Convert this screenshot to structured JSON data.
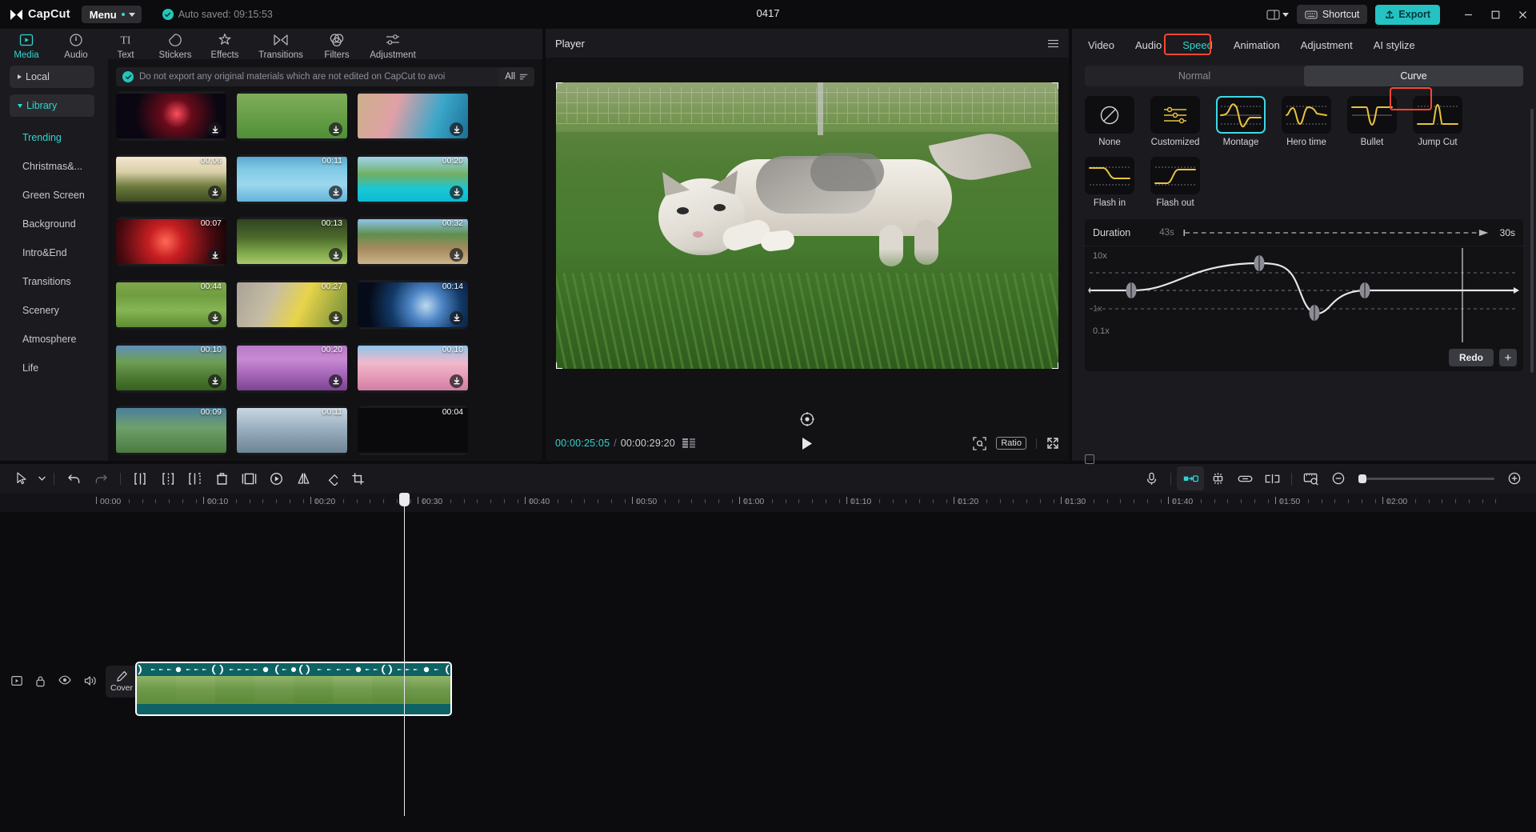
{
  "titlebar": {
    "app_name": "CapCut",
    "menu_label": "Menu",
    "autosave_text": "Auto saved: 09:15:53",
    "project_title": "0417",
    "shortcut_label": "Shortcut",
    "export_label": "Export",
    "minimize_icon": "minimize-icon",
    "maximize_icon": "maximize-icon",
    "close_icon": "close-icon",
    "layout_icon": "layout-icon"
  },
  "nav_tabs": [
    {
      "label": "Media",
      "icon": "media-icon",
      "active": true
    },
    {
      "label": "Audio",
      "icon": "audio-icon",
      "active": false
    },
    {
      "label": "Text",
      "icon": "text-icon",
      "active": false
    },
    {
      "label": "Stickers",
      "icon": "stickers-icon",
      "active": false
    },
    {
      "label": "Effects",
      "icon": "effects-icon",
      "active": false
    },
    {
      "label": "Transitions",
      "icon": "transitions-icon",
      "active": false
    },
    {
      "label": "Filters",
      "icon": "filters-icon",
      "active": false
    },
    {
      "label": "Adjustment",
      "icon": "adjustment-icon",
      "active": false
    }
  ],
  "library": {
    "local_label": "Local",
    "library_label": "Library",
    "categories": [
      {
        "label": "Trending",
        "active": true
      },
      {
        "label": "Christmas&...",
        "active": false
      },
      {
        "label": "Green Screen",
        "active": false
      },
      {
        "label": "Background",
        "active": false
      },
      {
        "label": "Intro&End",
        "active": false
      },
      {
        "label": "Transitions",
        "active": false
      },
      {
        "label": "Scenery",
        "active": false
      },
      {
        "label": "Atmosphere",
        "active": false
      },
      {
        "label": "Life",
        "active": false
      }
    ]
  },
  "notice": {
    "text": "Do not export any original materials which are not edited on CapCut to avoi",
    "close_icon": "close-icon",
    "shield_icon": "shield-check-icon"
  },
  "filter": {
    "label": "All",
    "icon": "filter-icon"
  },
  "media_grid": [
    {
      "duration": "",
      "thumb": "fireworks-dark",
      "downloadable": true
    },
    {
      "duration": "",
      "thumb": "cheer-team-grass",
      "downloadable": true
    },
    {
      "duration": "",
      "thumb": "beach-cliff-people",
      "downloadable": true
    },
    {
      "duration": "00:06",
      "thumb": "forest-sunrise",
      "downloadable": true
    },
    {
      "duration": "00:11",
      "thumb": "ocean-blue",
      "downloadable": true
    },
    {
      "duration": "00:20",
      "thumb": "pool-summer",
      "downloadable": true
    },
    {
      "duration": "00:07",
      "thumb": "fireworks-red",
      "downloadable": true
    },
    {
      "duration": "00:13",
      "thumb": "family-park",
      "downloadable": true
    },
    {
      "duration": "00:32",
      "thumb": "hiker-trail",
      "downloadable": true
    },
    {
      "duration": "00:44",
      "thumb": "kitten-grass",
      "downloadable": true
    },
    {
      "duration": "00:27",
      "thumb": "daffodils",
      "downloadable": true
    },
    {
      "duration": "00:14",
      "thumb": "earth-space",
      "downloadable": true
    },
    {
      "duration": "00:10",
      "thumb": "watering-plants",
      "downloadable": true
    },
    {
      "duration": "00:20",
      "thumb": "purple-flowers",
      "downloadable": true
    },
    {
      "duration": "00:10",
      "thumb": "cherry-blossom",
      "downloadable": true
    },
    {
      "duration": "00:09",
      "thumb": "river-stream",
      "downloadable": true
    },
    {
      "duration": "00:11",
      "thumb": "snow-scene",
      "downloadable": true
    },
    {
      "duration": "00:04",
      "thumb": "black-clip",
      "downloadable": true
    }
  ],
  "player": {
    "title": "Player",
    "menu_icon": "hamburger-icon",
    "current_time": "00:00:25:05",
    "separator": "/",
    "total_time": "00:00:29:20",
    "frames_icon": "frames-icon",
    "play_icon": "play-icon",
    "zoom_icon": "magnify-icon",
    "ratio_label": "Ratio",
    "fullscreen_icon": "fullscreen-icon",
    "recenter_icon": "recenter-icon"
  },
  "right_panel": {
    "tabs": [
      {
        "label": "Video",
        "active": false
      },
      {
        "label": "Audio",
        "active": false
      },
      {
        "label": "Speed",
        "active": true,
        "highlighted": true
      },
      {
        "label": "Animation",
        "active": false
      },
      {
        "label": "Adjustment",
        "active": false
      },
      {
        "label": "AI stylize",
        "active": false
      }
    ],
    "segments": [
      {
        "label": "Normal",
        "active": false
      },
      {
        "label": "Curve",
        "active": true,
        "highlighted": true
      }
    ],
    "presets": [
      {
        "label": "None",
        "icon": "none-circle-slash-icon",
        "selected": false
      },
      {
        "label": "Customized",
        "icon": "sliders-icon",
        "selected": false
      },
      {
        "label": "Montage",
        "icon": "curve-montage-icon",
        "selected": true
      },
      {
        "label": "Hero time",
        "icon": "curve-hero-time-icon",
        "selected": false
      },
      {
        "label": "Bullet",
        "icon": "curve-bullet-icon",
        "selected": false
      },
      {
        "label": "Jump Cut",
        "icon": "curve-jump-cut-icon",
        "selected": false
      },
      {
        "label": "Flash in",
        "icon": "curve-flash-in-icon",
        "selected": false
      },
      {
        "label": "Flash out",
        "icon": "curve-flash-out-icon",
        "selected": false
      }
    ],
    "duration": {
      "label": "Duration",
      "original_value": "43s",
      "result_value": "30s"
    },
    "curve_graph": {
      "top_label": "10x",
      "mid_label": "1x",
      "bottom_label": "0.1x"
    },
    "redo_label": "Redo",
    "add_label": "+",
    "highlight_color": "#ff4632",
    "accent_color": "#2fd5d0"
  },
  "timeline": {
    "tools": [
      {
        "icon": "select-cursor-icon"
      },
      {
        "icon": "chevron-down-icon"
      },
      {
        "icon": "undo-icon"
      },
      {
        "icon": "redo-icon"
      },
      {
        "icon": "split-icon"
      },
      {
        "icon": "trim-left-icon"
      },
      {
        "icon": "trim-right-icon"
      },
      {
        "icon": "delete-icon"
      },
      {
        "icon": "crop-frame-icon"
      },
      {
        "icon": "freeze-frame-icon"
      },
      {
        "icon": "mirror-icon"
      },
      {
        "icon": "rotate-icon"
      },
      {
        "icon": "crop-icon"
      }
    ],
    "right_tools": [
      {
        "icon": "microphone-icon",
        "active": false
      },
      {
        "icon": "auto-subtitle-icon",
        "active": true
      },
      {
        "icon": "magnet-icon",
        "active": false
      },
      {
        "icon": "link-icon",
        "active": false
      },
      {
        "icon": "adsorb-icon",
        "active": false
      },
      {
        "icon": "preview-ruler-icon",
        "active": false
      },
      {
        "icon": "zoom-out-icon",
        "active": false
      },
      {
        "icon": "zoom-in-icon",
        "active": false
      }
    ],
    "ruler_labels": [
      "00:00",
      "00:10",
      "00:20",
      "00:30",
      "00:40",
      "00:50",
      "01:00",
      "01:10",
      "01:20",
      "01:30",
      "01:40",
      "01:50",
      "02:00"
    ],
    "track_controls": [
      {
        "icon": "track-thumbnail-icon"
      },
      {
        "icon": "lock-icon"
      },
      {
        "icon": "eye-icon"
      },
      {
        "icon": "volume-icon"
      }
    ],
    "cover_label": "Cover",
    "cover_icon": "pencil-icon"
  }
}
